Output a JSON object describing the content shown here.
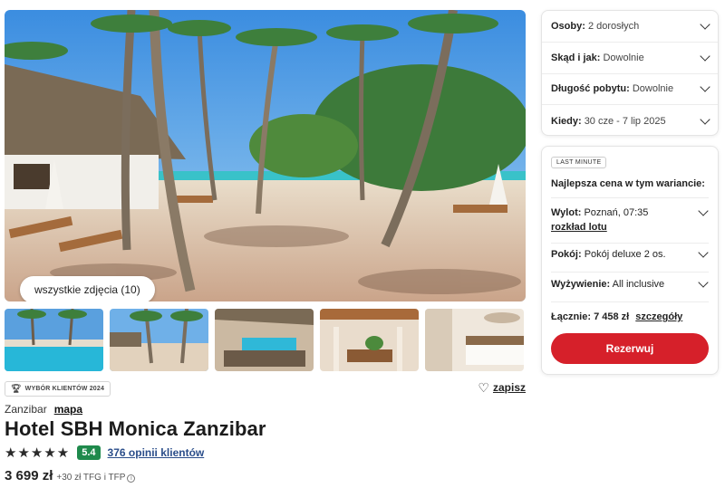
{
  "gallery": {
    "all_photos_label": "wszystkie zdjęcia (10)",
    "thumbnails": [
      "pool",
      "beach-palms",
      "pool-bar",
      "lobby",
      "room"
    ]
  },
  "badge": {
    "icon": "trophy-icon",
    "label": "WYBÓR KLIENTÓW 2024"
  },
  "save": {
    "icon": "heart-icon",
    "label": "zapisz"
  },
  "hotel": {
    "location": "Zanzibar",
    "map_link": "mapa",
    "name": "Hotel SBH Monica Zanzibar",
    "stars": "★★★★★",
    "star_count": 5,
    "score": "5.4",
    "reviews_link": "376 opinii klientów",
    "price": "3 699 zł",
    "price_extra": "+30 zł TFG i TFP"
  },
  "filters": [
    {
      "label": "Osoby:",
      "value": "2 dorosłych"
    },
    {
      "label": "Skąd i jak:",
      "value": "Dowolnie"
    },
    {
      "label": "Długość pobytu:",
      "value": "Dowolnie"
    },
    {
      "label": "Kiedy:",
      "value": "30 cze - 7 lip 2025"
    }
  ],
  "offer": {
    "tag": "LAST MINUTE",
    "heading": "Najlepsza cena w tym wariancie:",
    "flight_label": "Wylot:",
    "flight_value": "Poznań, 07:35",
    "schedule_link": "rozkład lotu",
    "room_label": "Pokój:",
    "room_value": "Pokój deluxe 2 os.",
    "board_label": "Wyżywienie:",
    "board_value": "All inclusive",
    "total_label": "Łącznie:",
    "total_value": "7 458 zł",
    "details_link": "szczegóły",
    "book_button": "Rezerwuj",
    "accent_color": "#d6202a"
  }
}
